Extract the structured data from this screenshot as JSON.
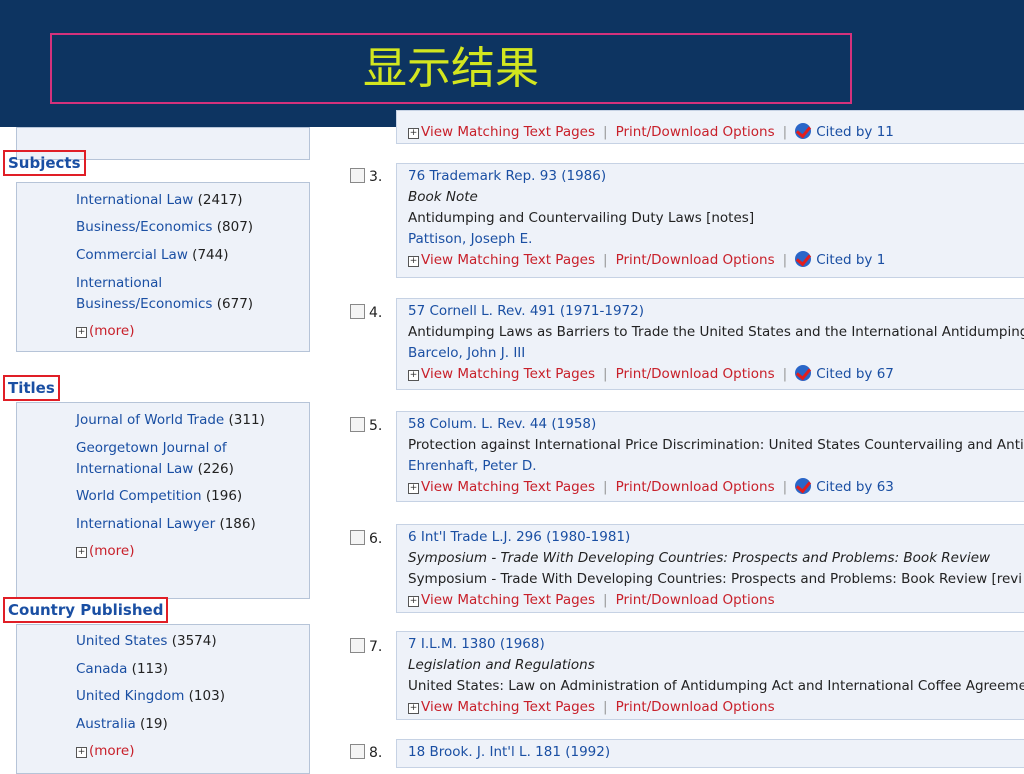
{
  "header": {
    "title": "显示结果"
  },
  "sidebar": {
    "subjects": {
      "heading": "Subjects",
      "items": [
        {
          "label": "International Law",
          "count": "(2417)"
        },
        {
          "label": "Business/Economics",
          "count": "(807)"
        },
        {
          "label": "Commercial Law",
          "count": "(744)"
        },
        {
          "label": "International",
          "label2": "Business/Economics",
          "count": "(677)"
        }
      ],
      "more": "(more)"
    },
    "titles": {
      "heading": "Titles",
      "items": [
        {
          "label": "Journal of World Trade",
          "count": "(311)"
        },
        {
          "label": "Georgetown Journal of",
          "label2": "International Law",
          "count": "(226)"
        },
        {
          "label": "World Competition",
          "count": "(196)"
        },
        {
          "label": "International Lawyer",
          "count": "(186)"
        }
      ],
      "more": "(more)"
    },
    "country": {
      "heading": "Country Published",
      "items": [
        {
          "label": "United States",
          "count": "(3574)"
        },
        {
          "label": "Canada",
          "count": "(113)"
        },
        {
          "label": "United Kingdom",
          "count": "(103)"
        },
        {
          "label": "Australia",
          "count": "(19)"
        }
      ],
      "more": "(more)"
    }
  },
  "actions": {
    "view_label": "View Matching Text Pages",
    "print_label": "Print/Download Options",
    "separator": "|"
  },
  "top_partial": {
    "cited": "Cited by 11"
  },
  "results": [
    {
      "num": "3.",
      "cite": "76 Trademark Rep. 93 (1986)",
      "type": "Book Note",
      "title": "Antidumping and Countervailing Duty Laws [notes]",
      "author": "Pattison, Joseph E.",
      "cited": "Cited by 1"
    },
    {
      "num": "4.",
      "cite": "57 Cornell L. Rev. 491 (1971-1972)",
      "title": "Antidumping Laws as Barriers to Trade the United States and the International Antidumping",
      "author": "Barcelo, John J. III",
      "cited": "Cited by 67"
    },
    {
      "num": "5.",
      "cite": "58 Colum. L. Rev. 44 (1958)",
      "title": "Protection against International Price Discrimination: United States Countervailing and Antidu",
      "author": "Ehrenhaft, Peter D.",
      "cited": "Cited by 63"
    },
    {
      "num": "6.",
      "cite": "6 Int'l Trade L.J. 296 (1980-1981)",
      "type": "Symposium - Trade With Developing Countries: Prospects and Problems: Book Review",
      "title": "Symposium - Trade With Developing Countries: Prospects and Problems: Book Review [revi"
    },
    {
      "num": "7.",
      "cite": "7 I.L.M. 1380 (1968)",
      "type": "Legislation and Regulations",
      "title": "United States: Law on Administration of Antidumping Act and International Coffee Agreemer"
    },
    {
      "num": "8.",
      "cite": "18 Brook. J. Int'l L. 181 (1992)"
    }
  ],
  "colors": {
    "header_bg": "#0d3461",
    "title": "#d3e61f",
    "box_border": "#d4327c",
    "heading": "#1a4fa3",
    "red_accent": "#c8202a"
  }
}
